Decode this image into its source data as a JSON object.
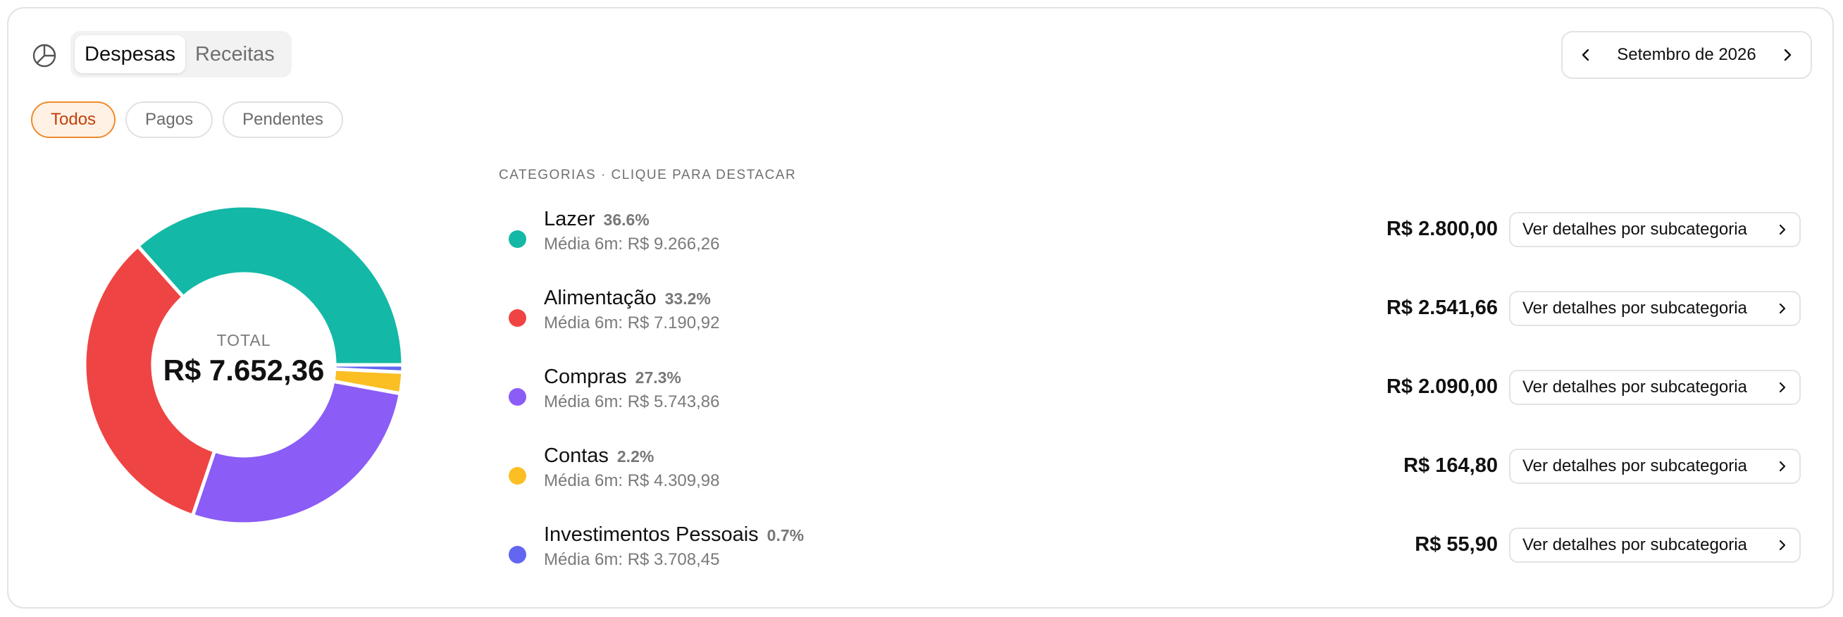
{
  "header": {
    "tabs": [
      {
        "label": "Despesas",
        "active": true
      },
      {
        "label": "Receitas",
        "active": false
      }
    ],
    "period": "Setembro de 2026"
  },
  "filters": [
    {
      "label": "Todos",
      "active": true
    },
    {
      "label": "Pagos",
      "active": false
    },
    {
      "label": "Pendentes",
      "active": false
    }
  ],
  "summary": {
    "total_label": "TOTAL",
    "total_value": "R$ 7.652,36"
  },
  "categories_title": "CATEGORIAS · CLIQUE PARA DESTACAR",
  "categories": [
    {
      "name": "Lazer",
      "pct": "36.6%",
      "avg": "Média 6m: R$ 9.266,26",
      "amount": "R$ 2.800,00",
      "value": 2800.0,
      "color": "#14b8a6",
      "button": "Ver detalhes por subcategoria"
    },
    {
      "name": "Alimentação",
      "pct": "33.2%",
      "avg": "Média 6m: R$ 7.190,92",
      "amount": "R$ 2.541,66",
      "value": 2541.66,
      "color": "#ef4444",
      "button": "Ver detalhes por subcategoria"
    },
    {
      "name": "Compras",
      "pct": "27.3%",
      "avg": "Média 6m: R$ 5.743,86",
      "amount": "R$ 2.090,00",
      "value": 2090.0,
      "color": "#8b5cf6",
      "button": "Ver detalhes por subcategoria"
    },
    {
      "name": "Contas",
      "pct": "2.2%",
      "avg": "Média 6m: R$ 4.309,98",
      "amount": "R$ 164,80",
      "value": 164.8,
      "color": "#fbbf24",
      "button": "Ver detalhes por subcategoria"
    },
    {
      "name": "Investimentos Pessoais",
      "pct": "0.7%",
      "avg": "Média 6m: R$ 3.708,45",
      "amount": "R$ 55,90",
      "value": 55.9,
      "color": "#6366f1",
      "button": "Ver detalhes por subcategoria"
    }
  ],
  "chart_data": {
    "type": "pie",
    "categories": [
      "Lazer",
      "Alimentação",
      "Compras",
      "Contas",
      "Investimentos Pessoais"
    ],
    "values": [
      2800.0,
      2541.66,
      2090.0,
      164.8,
      55.9
    ],
    "colors": [
      "#14b8a6",
      "#ef4444",
      "#8b5cf6",
      "#fbbf24",
      "#6366f1"
    ],
    "donut": true,
    "center_label": "TOTAL",
    "center_value": "R$ 7.652,36"
  },
  "icons": {
    "header": "pie-chart-icon",
    "prev": "chevron-left-icon",
    "next": "chevron-right-icon",
    "row_button": "chevron-right-icon"
  }
}
